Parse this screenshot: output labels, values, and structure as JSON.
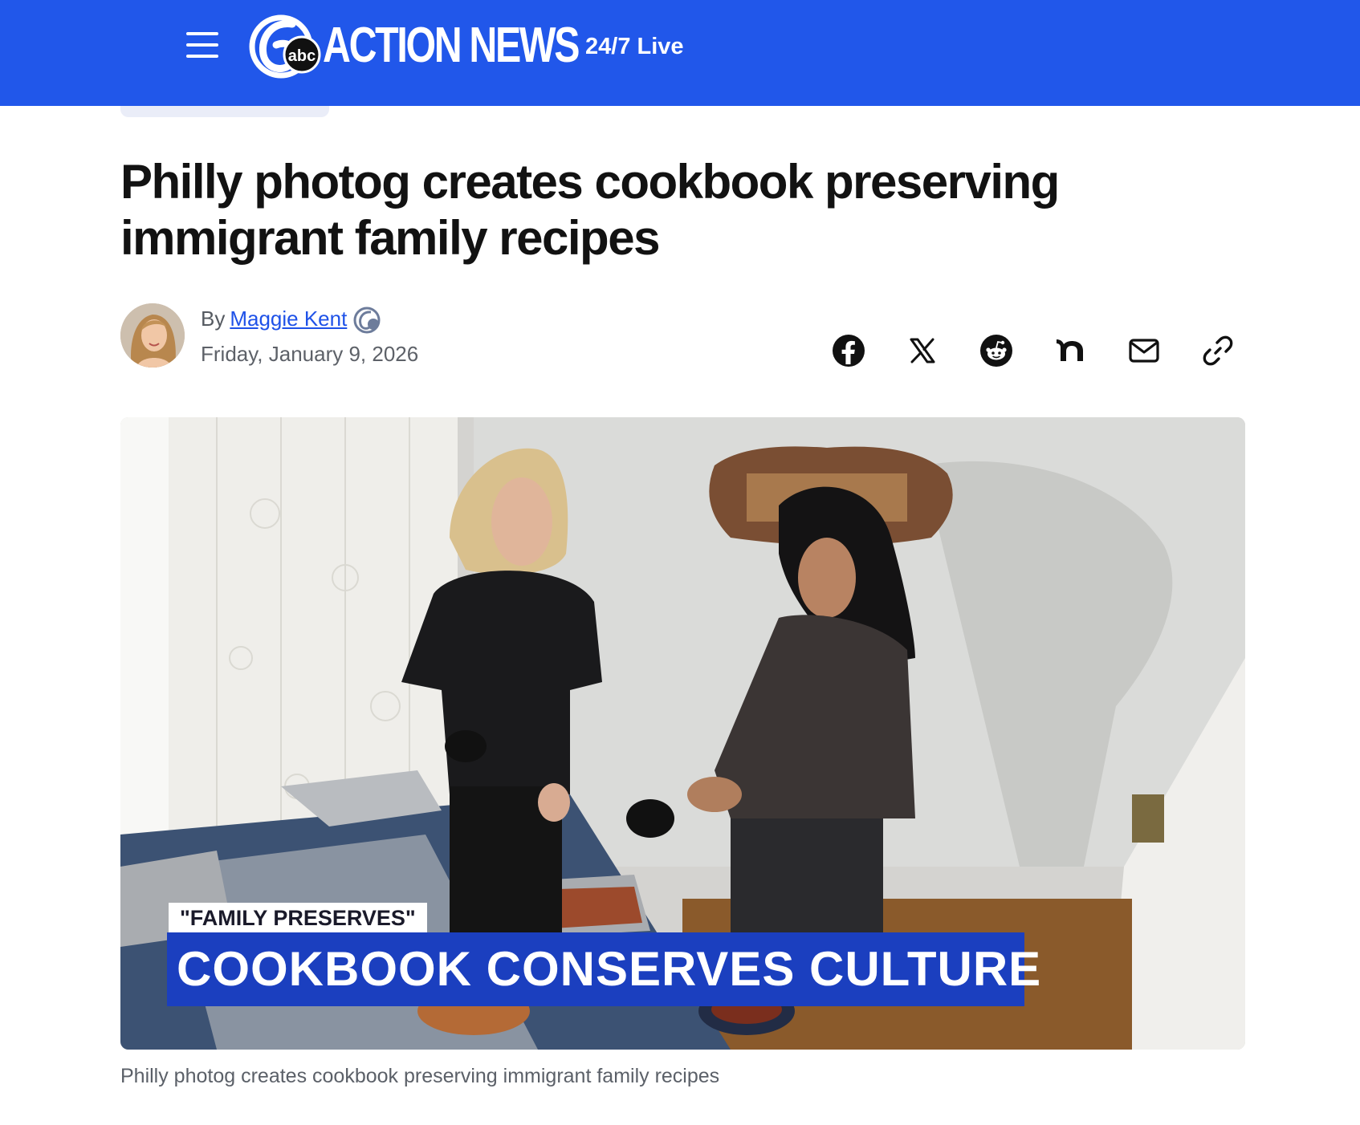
{
  "header": {
    "brand": "ACTION NEWS",
    "brand_badge": "abc",
    "live_label": "24/7 Live",
    "bg_color": "#2157ea"
  },
  "article": {
    "headline": "Philly photog creates cookbook preserving immigrant family recipes",
    "byline_prefix": "By",
    "author": "Maggie Kent",
    "date": "Friday, January 9, 2026"
  },
  "share": {
    "icons": [
      "facebook-icon",
      "x-icon",
      "reddit-icon",
      "nextdoor-icon",
      "email-icon",
      "link-icon"
    ]
  },
  "video": {
    "tag": "\"FAMILY PRESERVES\"",
    "title": "COOKBOOK CONSERVES CULTURE",
    "bar_color": "#1b3fbf"
  },
  "caption": "Philly photog creates cookbook preserving immigrant family recipes"
}
